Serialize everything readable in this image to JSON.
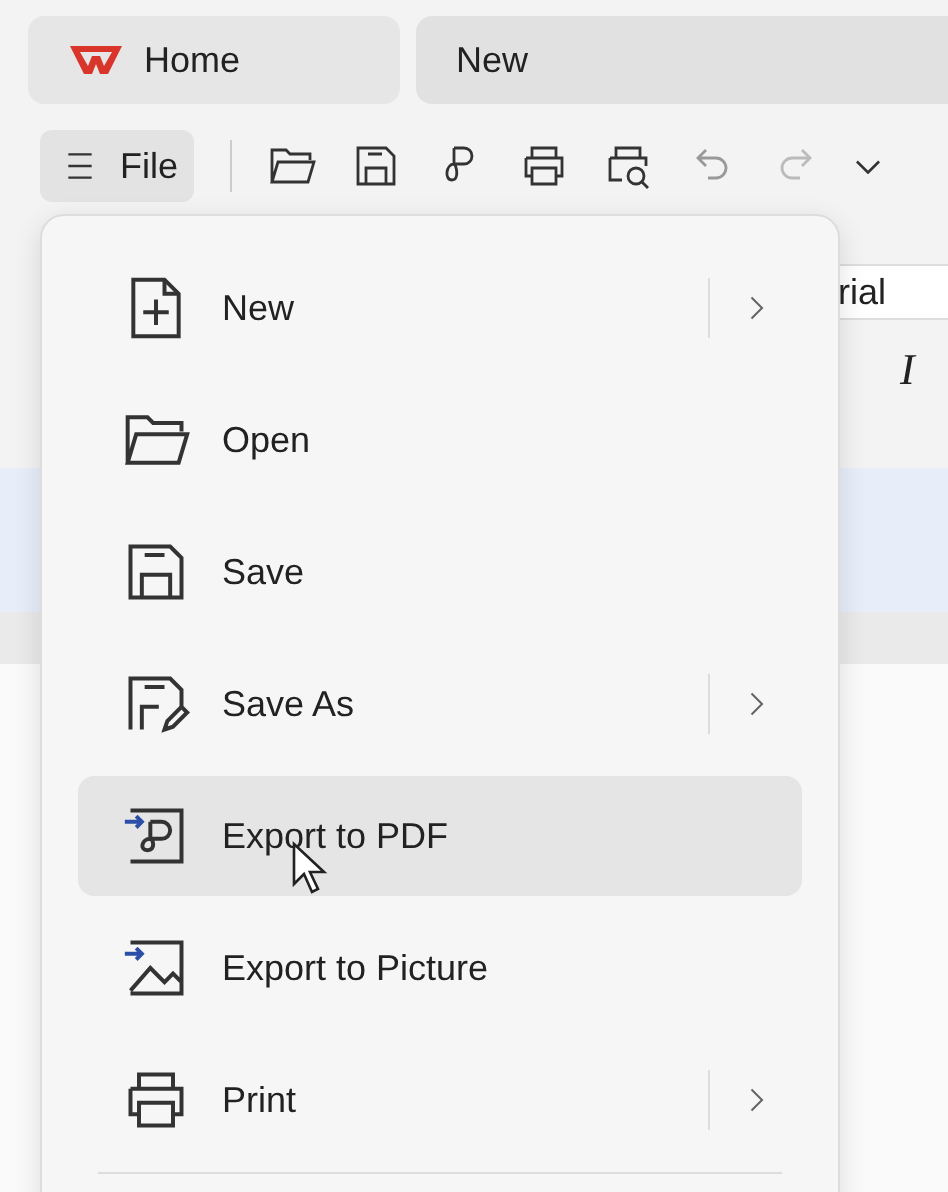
{
  "tabs": [
    {
      "label": "Home",
      "kind": "home",
      "selected": false
    },
    {
      "label": "New",
      "kind": "doc",
      "selected": true
    }
  ],
  "toolbar": {
    "file_label": "File",
    "icons": [
      {
        "kind": "open"
      },
      {
        "kind": "save"
      },
      {
        "kind": "pdf"
      },
      {
        "kind": "print"
      },
      {
        "kind": "preview"
      },
      {
        "kind": "undo"
      },
      {
        "kind": "redo"
      },
      {
        "kind": "more"
      }
    ]
  },
  "document": {
    "font_field": "rial",
    "italic_button": "I"
  },
  "file_menu": {
    "items": [
      {
        "label": "New",
        "kind": "new",
        "submenu": true,
        "highlighted": false
      },
      {
        "label": "Open",
        "kind": "open",
        "submenu": false,
        "highlighted": false
      },
      {
        "label": "Save",
        "kind": "save",
        "submenu": false,
        "highlighted": false
      },
      {
        "label": "Save As",
        "kind": "saveas",
        "submenu": true,
        "highlighted": false
      },
      {
        "label": "Export to PDF",
        "kind": "pdf",
        "submenu": false,
        "highlighted": true
      },
      {
        "label": "Export to Picture",
        "kind": "picture",
        "submenu": false,
        "highlighted": false
      },
      {
        "label": "Print",
        "kind": "print",
        "submenu": true,
        "highlighted": false
      }
    ]
  }
}
